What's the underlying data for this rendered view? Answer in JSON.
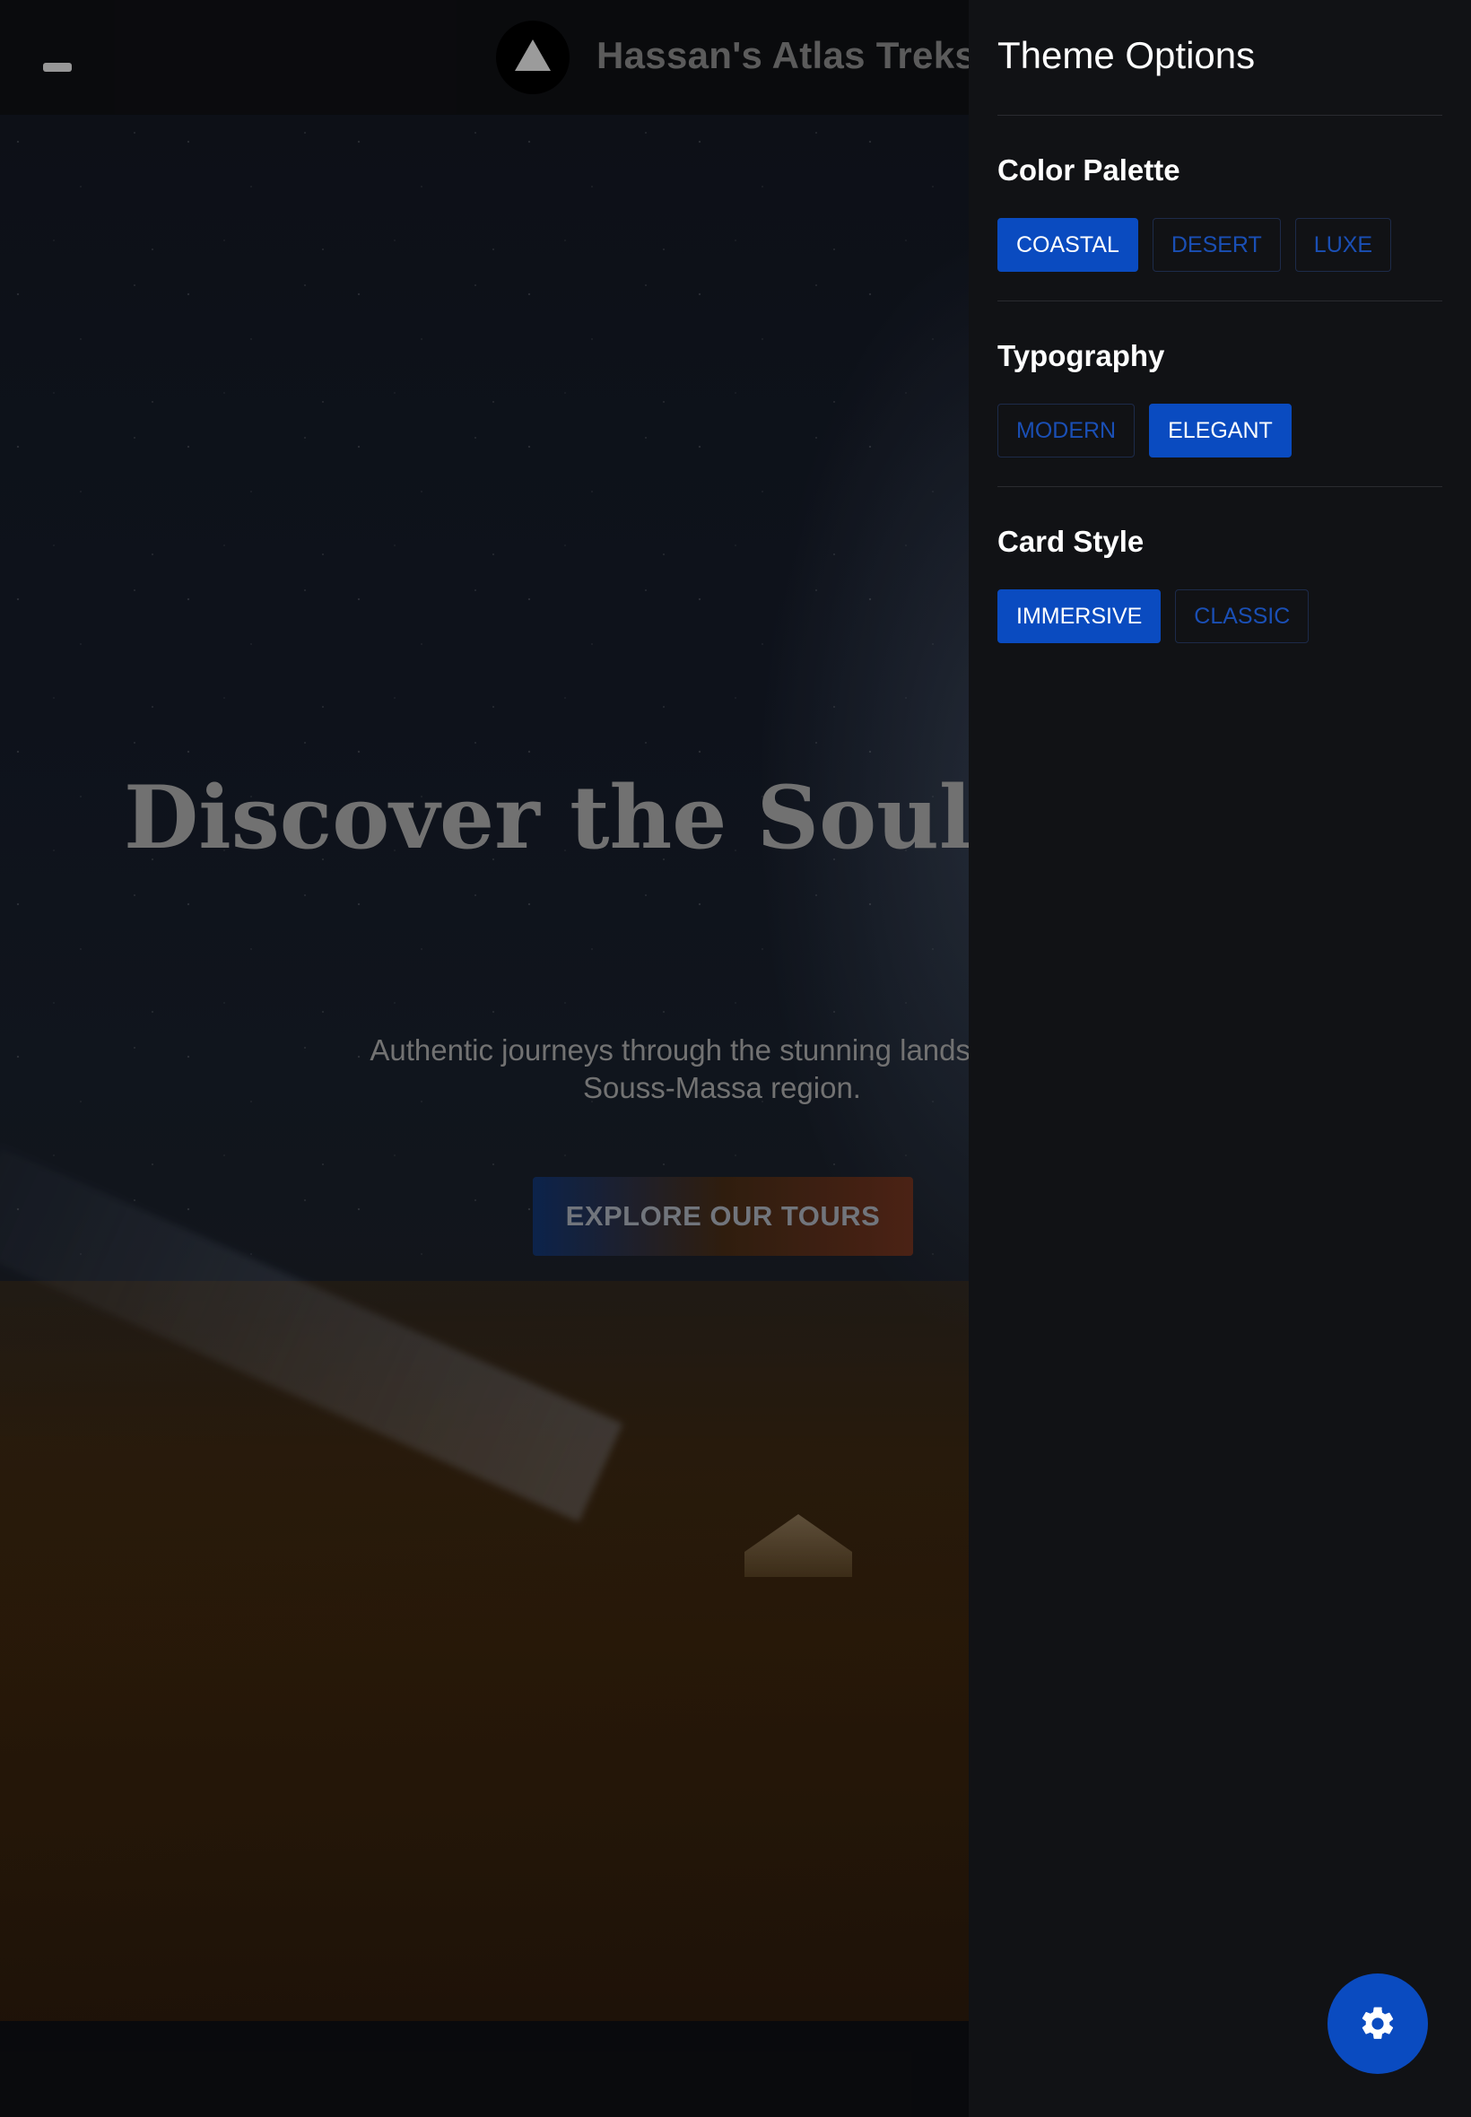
{
  "header": {
    "brand": "Hassan's Atlas Treks"
  },
  "hero": {
    "title": "Discover the Soul of",
    "subtitle": "Authentic journeys through the stunning landscapes a",
    "subtitle_line2": "Souss-Massa region.",
    "cta_label": "EXPLORE OUR TOURS"
  },
  "drawer": {
    "title": "Theme Options",
    "sections": [
      {
        "title": "Color Palette",
        "options": [
          "COASTAL",
          "DESERT",
          "LUXE"
        ],
        "selected": "COASTAL"
      },
      {
        "title": "Typography",
        "options": [
          "MODERN",
          "ELEGANT"
        ],
        "selected": "ELEGANT"
      },
      {
        "title": "Card Style",
        "options": [
          "IMMERSIVE",
          "CLASSIC"
        ],
        "selected": "IMMERSIVE"
      }
    ]
  },
  "colors": {
    "accent": "#0a4bc0",
    "drawer_bg": "#111215"
  },
  "icons": {
    "fab": "gear-icon",
    "menu": "menu-icon",
    "logo": "mountain-icon"
  }
}
